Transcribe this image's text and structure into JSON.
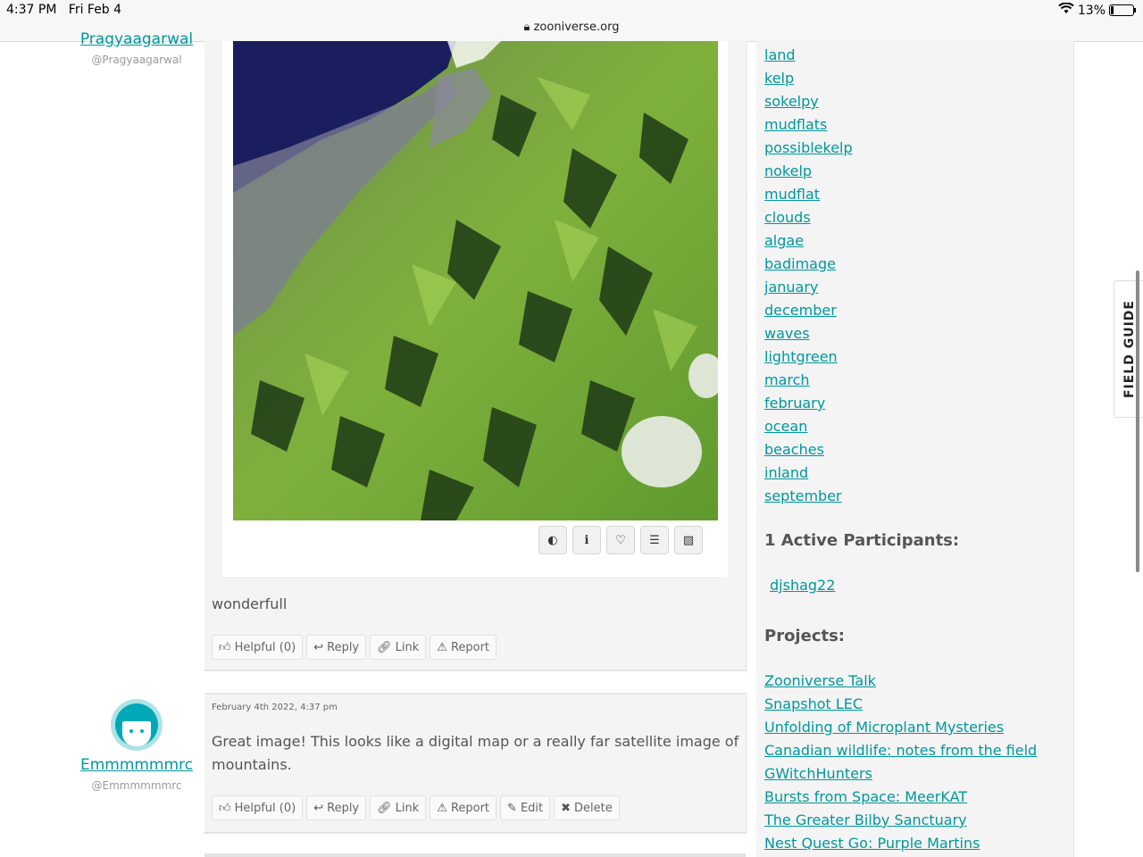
{
  "status_bar": {
    "time": "4:37 PM",
    "date": "Fri Feb 4",
    "url": "zooniverse.org",
    "battery": "13%"
  },
  "post1": {
    "username": "Pragyaagarwal",
    "handle": "@Pragyaagarwal",
    "body": "wonderfull",
    "image_tools": [
      "contrast-icon",
      "info-icon",
      "heart-icon",
      "list-icon",
      "image-icon"
    ],
    "actions": {
      "helpful": "Helpful (0)",
      "reply": "Reply",
      "link": "Link",
      "report": "Report"
    }
  },
  "post2": {
    "username": "Emmmmmmrc",
    "handle": "@Emmmmmmrc",
    "timestamp": "February 4th 2022, 4:37 pm",
    "body": "Great image! This looks like a digital map or a really far satellite image of mountains.",
    "actions": {
      "helpful": "Helpful (0)",
      "reply": "Reply",
      "link": "Link",
      "report": "Report",
      "edit": "Edit",
      "delete": "Delete"
    }
  },
  "sidebar": {
    "tags": [
      "land",
      "kelp",
      "sokelpy",
      "mudflats",
      "possiblekelp",
      "nokelp",
      "mudflat",
      "clouds",
      "algae",
      "badimage",
      "january",
      "december",
      "waves",
      "lightgreen",
      "march",
      "february",
      "ocean",
      "beaches",
      "inland",
      "september"
    ],
    "participants_heading": "1 Active Participants:",
    "participants": [
      "djshag22"
    ],
    "projects_heading": "Projects:",
    "projects": [
      "Zooniverse Talk",
      "Snapshot LEC",
      "Unfolding of Microplant Mysteries",
      "Canadian wildlife: notes from the field",
      "GWitchHunters",
      "Bursts from Space: MeerKAT",
      "The Greater Bilby Sanctuary",
      "Nest Quest Go: Purple Martins"
    ]
  },
  "field_guide": "FIELD GUIDE",
  "colors": {
    "link": "#00979d",
    "card_bg": "#f4f4f4",
    "text": "#555555"
  }
}
